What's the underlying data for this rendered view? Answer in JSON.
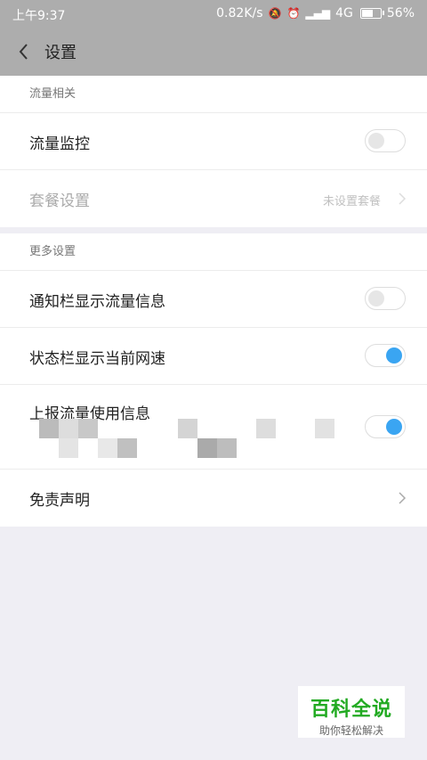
{
  "status_bar": {
    "time": "上午9:37",
    "speed": "0.82K/s",
    "network": "4G",
    "battery": "56%"
  },
  "nav": {
    "title": "设置",
    "back_icon": "chevron-left-icon"
  },
  "section1": {
    "header": "流量相关",
    "rows": [
      {
        "label": "流量监控",
        "toggle": "off"
      },
      {
        "label": "套餐设置",
        "value": "未设置套餐"
      }
    ]
  },
  "section2": {
    "header": "更多设置",
    "rows": [
      {
        "label": "通知栏显示流量信息",
        "toggle": "off"
      },
      {
        "label": "状态栏显示当前网速",
        "toggle": "on"
      },
      {
        "label": "上报流量使用信息",
        "toggle": "on"
      },
      {
        "label": "免责声明"
      }
    ]
  },
  "watermark": {
    "title": "百科全说",
    "subtitle": "助你轻松解决"
  },
  "colors": {
    "accent": "#3aa5f2",
    "header_bg": "#adadad",
    "page_bg": "#efeef4",
    "watermark_green": "#22aa22"
  }
}
